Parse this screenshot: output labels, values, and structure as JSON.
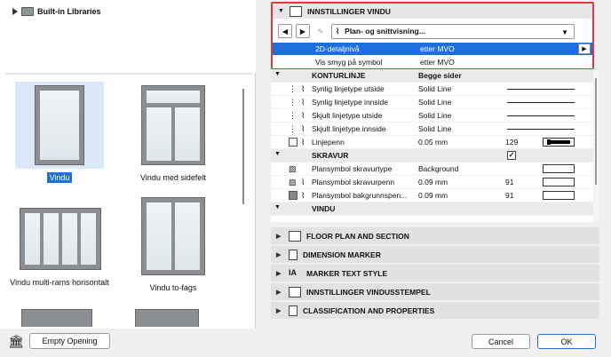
{
  "library": {
    "tree_item": "Built-in Libraries",
    "thumbnails": [
      {
        "label": "Vindu",
        "selected": true
      },
      {
        "label": "Vindu med sidefelt",
        "selected": false
      },
      {
        "label": "Vindu multi-rams horisontalt",
        "selected": false
      },
      {
        "label": "Vindu to-fags",
        "selected": false
      }
    ],
    "empty_opening_label": "Empty Opening"
  },
  "settings": {
    "top_section_title": "INNSTILLINGER VINDU",
    "view_dropdown": "Plan- og snittvisning...",
    "rows": [
      {
        "name": "2D-detaljnivå",
        "value": "etter MVO",
        "selected": true
      },
      {
        "name": "Vis smyg på symbol",
        "value": "etter MVO",
        "selected": false
      }
    ],
    "table": [
      {
        "kind": "group",
        "name": "KONTURLINJE",
        "value": "Begge sider"
      },
      {
        "kind": "row",
        "name": "Synlig linjetype utside",
        "value": "Solid Line",
        "line": true
      },
      {
        "kind": "row",
        "name": "Synlig linjetype innside",
        "value": "Solid Line",
        "line": true
      },
      {
        "kind": "row",
        "name": "Skjult linjetype utside",
        "value": "Solid Line",
        "line": true
      },
      {
        "kind": "row",
        "name": "Skjult linjetype innside",
        "value": "Solid Line",
        "line": true
      },
      {
        "kind": "row",
        "name": "Linjepenn",
        "value": "0.05 mm",
        "num": "129",
        "swatch": "dark"
      },
      {
        "kind": "group",
        "name": "SKRAVUR",
        "value": "",
        "checkbox": "✓"
      },
      {
        "kind": "row",
        "name": "Plansymbol skravurtype",
        "value": "Background",
        "swatch": "white"
      },
      {
        "kind": "row",
        "name": "Plansymbol skravurpenn",
        "value": "0.09 mm",
        "num": "91",
        "swatch": "white"
      },
      {
        "kind": "row",
        "name": "Plansymbol bakgrunnspen...",
        "value": "0.09 mm",
        "num": "91",
        "swatch": "white"
      },
      {
        "kind": "group",
        "name": "VINDU",
        "value": ""
      }
    ],
    "collapsed_sections": [
      "FLOOR PLAN AND SECTION",
      "DIMENSION MARKER",
      "MARKER TEXT STYLE",
      "INNSTILLINGER VINDUSSTEMPEL",
      "CLASSIFICATION AND PROPERTIES"
    ]
  },
  "footer": {
    "cancel_label": "Cancel",
    "ok_label": "OK"
  },
  "colors": {
    "selection_blue": "#1e6fd9",
    "highlight_red": "#d93a3a"
  }
}
